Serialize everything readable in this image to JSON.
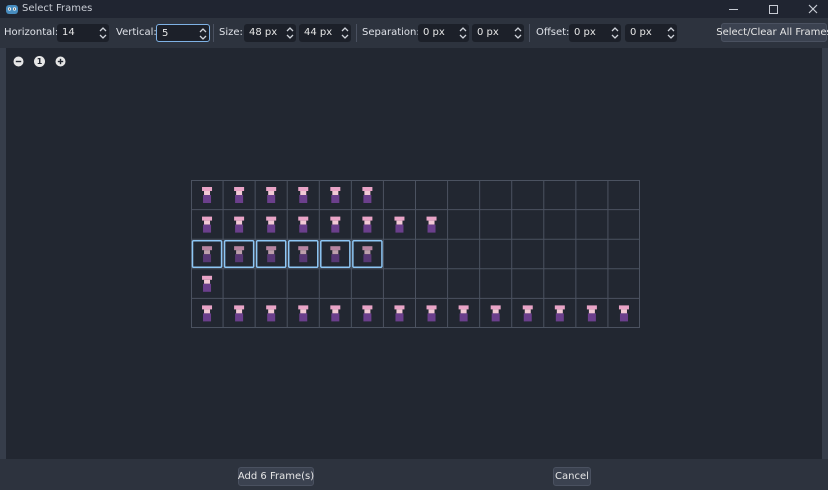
{
  "window": {
    "title": "Select Frames",
    "controls": [
      "minimize-icon",
      "maximize-icon",
      "close-icon"
    ]
  },
  "toolbar": {
    "horizontal_label": "Horizontal:",
    "horizontal_value": "14",
    "vertical_label": "Vertical:",
    "vertical_value": "5",
    "size_label": "Size:",
    "size_w": "48 px",
    "size_h": "44 px",
    "separation_label": "Separation:",
    "separation_x": "0 px",
    "separation_y": "0 px",
    "offset_label": "Offset:",
    "offset_x": "0 px",
    "offset_y": "0 px",
    "select_all_label": "Select/Clear All Frames"
  },
  "zoom": {
    "icons": [
      "zoom-out-icon",
      "zoom-reset-icon",
      "zoom-in-icon"
    ],
    "reset_glyph": "1"
  },
  "sprite_grid": {
    "columns": 14,
    "rows": 5,
    "row_sprite_counts": [
      6,
      8,
      6,
      1,
      14
    ],
    "selected_row": 3,
    "selected_count": 6
  },
  "footer": {
    "add_label": "Add 6 Frame(s)",
    "cancel_label": "Cancel"
  },
  "colors": {
    "selection_border": "#8ec7f5",
    "grid_line": "#4b5260",
    "sprite_hat": "#e9a4c7",
    "sprite_body": "#6b3f8c"
  }
}
